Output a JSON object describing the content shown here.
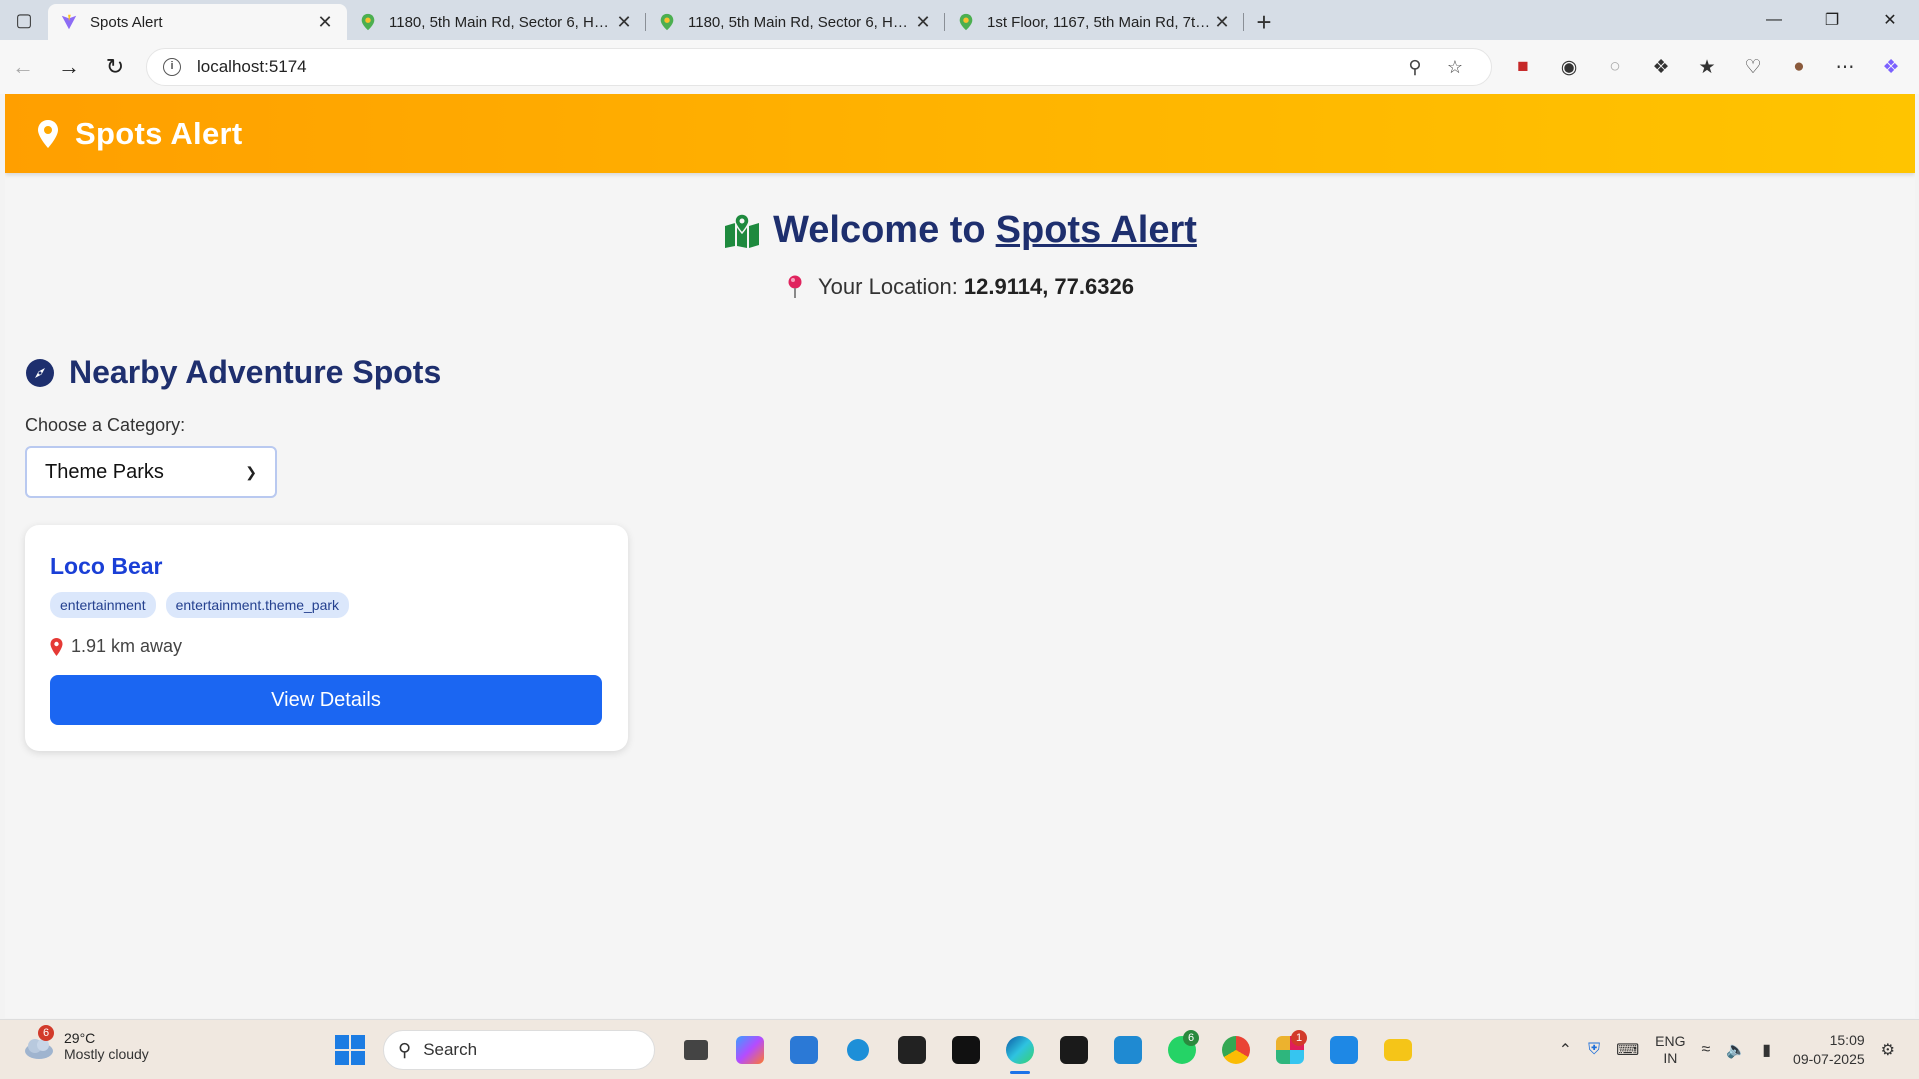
{
  "browser": {
    "tabs": [
      {
        "title": "Spots Alert",
        "active": true
      },
      {
        "title": "1180, 5th Main Rd, Sector 6, HSR Layout",
        "active": false
      },
      {
        "title": "1180, 5th Main Rd, Sector 6, HSR Layout",
        "active": false
      },
      {
        "title": "1st Floor, 1167, 5th Main Rd, 7th Sector",
        "active": false
      }
    ],
    "url": "localhost:5174"
  },
  "app": {
    "brand": "Spots Alert",
    "welcome_prefix": "Welcome to",
    "welcome_link": "Spots Alert",
    "location_label": "Your Location:",
    "location_value": "12.9114, 77.6326",
    "section_title": "Nearby Adventure Spots",
    "category_label": "Choose a Category:",
    "category_selected": "Theme Parks",
    "spots": [
      {
        "name": "Loco Bear",
        "tags": [
          "entertainment",
          "entertainment.theme_park"
        ],
        "distance": "1.91 km away",
        "button": "View Details"
      }
    ]
  },
  "taskbar": {
    "weather_badge": "6",
    "temperature": "29°C",
    "condition": "Mostly cloudy",
    "search_placeholder": "Search",
    "whatsapp_badge": "6",
    "slack_badge": "1",
    "lang_top": "ENG",
    "lang_bottom": "IN",
    "time": "15:09",
    "date": "09-07-2025"
  },
  "colors": {
    "header_gradient_start": "#ff9f00",
    "header_gradient_end": "#ffc400",
    "title_navy": "#1e2f6e",
    "spot_title_blue": "#1a3fd6",
    "button_blue": "#1b66f2",
    "tag_bg": "#dbe7fb"
  }
}
